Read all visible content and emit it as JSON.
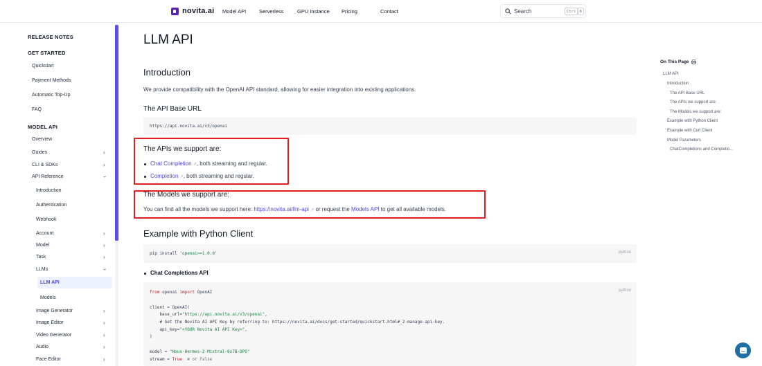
{
  "nav": {
    "brand": "novita.ai",
    "links": [
      "Model API",
      "Serverless",
      "GPU Instance",
      "Pricing",
      "Contact"
    ],
    "search_placeholder": "Search",
    "shortcut_ctrl": "Ctrl",
    "shortcut_key": "K"
  },
  "sidebar": {
    "release_notes": "RELEASE NOTES",
    "get_started": "GET STARTED",
    "quickstart": "Quickstart",
    "payment_methods": "Payment Methods",
    "auto_topup": "Automatic Top-Up",
    "faq": "FAQ",
    "model_api": "MODEL API",
    "overview": "Overview",
    "guides": "Guides",
    "cli_sdks": "CLI & SDKs",
    "api_reference": "API Reference",
    "introduction": "Introduction",
    "authentication": "Authentication",
    "webhook": "Webhook",
    "account": "Account",
    "model": "Model",
    "task": "Task",
    "llms": "LLMs",
    "llm_api": "LLM API",
    "models": "Models",
    "image_generator": "Image Generator",
    "image_editor": "Image Editor",
    "video_generator": "Video Generator",
    "audio": "Audio",
    "face_editor": "Face Editor"
  },
  "content": {
    "title": "LLM API",
    "intro_heading": "Introduction",
    "intro_text": "We provide compatibility with the OpenAI API standard, allowing for easier integration into existing applications.",
    "base_url_heading": "The API Base URL",
    "base_url": "https://api.novita.ai/v3/openai",
    "apis_heading": "The APIs we support are:",
    "api_1_link": "Chat Completion",
    "api_1_rest": ", both streaming and regular.",
    "api_2_link": "Completion",
    "api_2_rest": ", both streaming and regular.",
    "models_heading": "The Models we support are:",
    "models_text_1": "You can find all the models we support here: ",
    "models_link_1": "https://novita.ai/llm-api",
    "models_text_2": " or request the ",
    "models_link_2": "Models API",
    "models_text_3": " to get all available models.",
    "python_heading": "Example with Python Client",
    "pip_cmd": "pip install ",
    "pip_pkg": "'openai>=1.0.0'",
    "lang_label": "python",
    "chat_api_heading": "Chat Completions API",
    "code_from": "from",
    "code_openai": " openai ",
    "code_import": "import",
    "code_OpenAI": " OpenAI",
    "code_client": "client = OpenAI(",
    "code_base_url_key": "    base_url=",
    "code_base_url_val": "\"https://api.novita.ai/v3/openai\"",
    "code_comment": "    # Get the Novita AI API Key by referring to: https://novita.ai/docs/get-started/quickstart.html#_2-manage-api-key.",
    "code_api_key_key": "    api_key=",
    "code_api_key_val": "\"<YOUR Novita AI API Key>\"",
    "code_close": ")",
    "code_model_key": "model = ",
    "code_model_val": "\"Nous-Hermes-2-Mixtral-8x7B-DPO\"",
    "code_stream_key": "stream = ",
    "code_stream_val": "True",
    "code_stream_comment": "  # or False"
  },
  "toc": {
    "title": "On This Page",
    "items": [
      "LLM API",
      "Introduction",
      "The API Base URL",
      "The APIs we support are:",
      "The Models we support are:",
      "Example with Python Client",
      "Example with Curl Client",
      "Model Parameters",
      "ChatCompletions and Completio..."
    ]
  },
  "colors": {
    "accent": "#4f46e5",
    "highlight_box": "#e11d1d",
    "code_bg": "#f6f6f7"
  },
  "icons": {
    "search": "search-icon",
    "chevron": "chevron-right-icon",
    "external": "external-link-icon",
    "print": "print-icon",
    "chat": "chat-icon"
  }
}
